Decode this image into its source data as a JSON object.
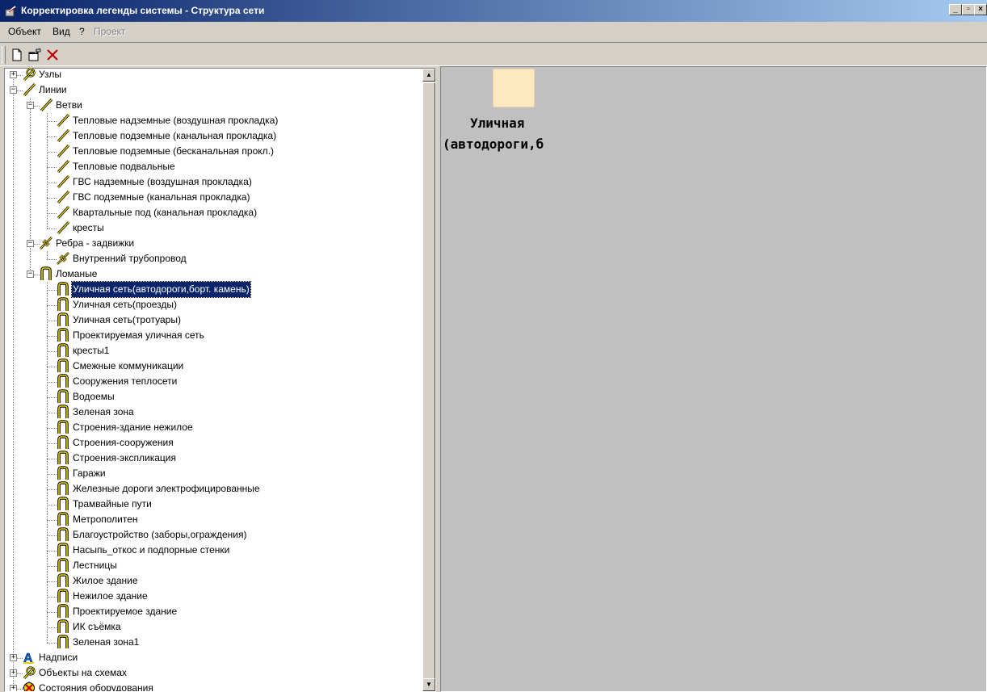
{
  "window": {
    "title": "Корректировка легенды системы - Структура сети"
  },
  "menu": [
    {
      "label": "Объект",
      "enabled": true
    },
    {
      "label": "Вид",
      "enabled": true
    },
    {
      "label": "?",
      "enabled": true
    },
    {
      "label": "Проект",
      "enabled": false
    }
  ],
  "toolbar": [
    "new-icon",
    "properties-icon",
    "delete-icon"
  ],
  "tree": [
    {
      "label": "Узлы",
      "level": 0,
      "expander": "+",
      "icon": "node-icon"
    },
    {
      "label": "Линии",
      "level": 0,
      "expander": "-",
      "icon": "line-icon"
    },
    {
      "label": "Ветви",
      "level": 1,
      "expander": "-",
      "icon": "line-icon"
    },
    {
      "label": "Тепловые надземные (воздушная прокладка)",
      "level": 2,
      "icon": "line-icon"
    },
    {
      "label": "Тепловые подземные (канальная прокладка)",
      "level": 2,
      "icon": "line-icon"
    },
    {
      "label": "Тепловые подземные (бесканальная прокл.)",
      "level": 2,
      "icon": "line-icon"
    },
    {
      "label": "Тепловые подвальные",
      "level": 2,
      "icon": "line-icon"
    },
    {
      "label": "ГВС надземные (воздушная прокладка)",
      "level": 2,
      "icon": "line-icon"
    },
    {
      "label": "ГВС подземные (канальная прокладка)",
      "level": 2,
      "icon": "line-icon"
    },
    {
      "label": "Квартальные под (канальная прокладка)",
      "level": 2,
      "icon": "line-icon"
    },
    {
      "label": "кресты",
      "level": 2,
      "icon": "line-icon"
    },
    {
      "label": "Ребра - задвижки",
      "level": 1,
      "expander": "-",
      "icon": "valve-icon"
    },
    {
      "label": "Внутренний трубопровод",
      "level": 2,
      "icon": "valve-icon"
    },
    {
      "label": "Ломаные",
      "level": 1,
      "expander": "-",
      "icon": "polyline-icon"
    },
    {
      "label": "Уличная сеть(автодороги,борт. камень)",
      "level": 2,
      "icon": "polyline-icon",
      "selected": true
    },
    {
      "label": "Уличная сеть(проезды)",
      "level": 2,
      "icon": "polyline-icon"
    },
    {
      "label": "Уличная сеть(тротуары)",
      "level": 2,
      "icon": "polyline-icon"
    },
    {
      "label": "Проектируемая уличная сеть",
      "level": 2,
      "icon": "polyline-icon"
    },
    {
      "label": "кресты1",
      "level": 2,
      "icon": "polyline-icon"
    },
    {
      "label": "Смежные коммуникации",
      "level": 2,
      "icon": "polyline-icon"
    },
    {
      "label": "Сооружения теплосети",
      "level": 2,
      "icon": "polyline-icon"
    },
    {
      "label": "Водоемы",
      "level": 2,
      "icon": "polyline-icon"
    },
    {
      "label": "Зеленая зона",
      "level": 2,
      "icon": "polyline-icon"
    },
    {
      "label": "Строения-здание нежилое",
      "level": 2,
      "icon": "polyline-icon"
    },
    {
      "label": "Строения-сооружения",
      "level": 2,
      "icon": "polyline-icon"
    },
    {
      "label": "Строения-экспликация",
      "level": 2,
      "icon": "polyline-icon"
    },
    {
      "label": "Гаражи",
      "level": 2,
      "icon": "polyline-icon"
    },
    {
      "label": "Железные дороги электрофицированные",
      "level": 2,
      "icon": "polyline-icon"
    },
    {
      "label": "Трамвайные пути",
      "level": 2,
      "icon": "polyline-icon"
    },
    {
      "label": "Метрополитен",
      "level": 2,
      "icon": "polyline-icon"
    },
    {
      "label": "Благоустройство (заборы,ограждения)",
      "level": 2,
      "icon": "polyline-icon"
    },
    {
      "label": "Насыпь_откос и подпорные стенки",
      "level": 2,
      "icon": "polyline-icon"
    },
    {
      "label": "Лестницы",
      "level": 2,
      "icon": "polyline-icon"
    },
    {
      "label": "Жилое здание",
      "level": 2,
      "icon": "polyline-icon"
    },
    {
      "label": "Нежилое здание",
      "level": 2,
      "icon": "polyline-icon"
    },
    {
      "label": "Проектируемое здание",
      "level": 2,
      "icon": "polyline-icon"
    },
    {
      "label": "ИК съёмка",
      "level": 2,
      "icon": "polyline-icon"
    },
    {
      "label": "Зеленая зона1",
      "level": 2,
      "icon": "polyline-icon"
    },
    {
      "label": "Надписи",
      "level": 0,
      "expander": "+",
      "icon": "text-icon"
    },
    {
      "label": "Объекты на схемах",
      "level": 0,
      "expander": "+",
      "icon": "node-icon"
    },
    {
      "label": "Состояния оборудования",
      "level": 0,
      "expander": "+",
      "icon": "equipment-state-icon"
    }
  ],
  "preview": {
    "line1": "Уличная",
    "line2": "(автодороги,б",
    "swatch_color": "#fde8c0"
  },
  "colors": {
    "selection": "#0a246a",
    "titlebar_start": "#0a246a",
    "titlebar_end": "#a6caf0"
  }
}
